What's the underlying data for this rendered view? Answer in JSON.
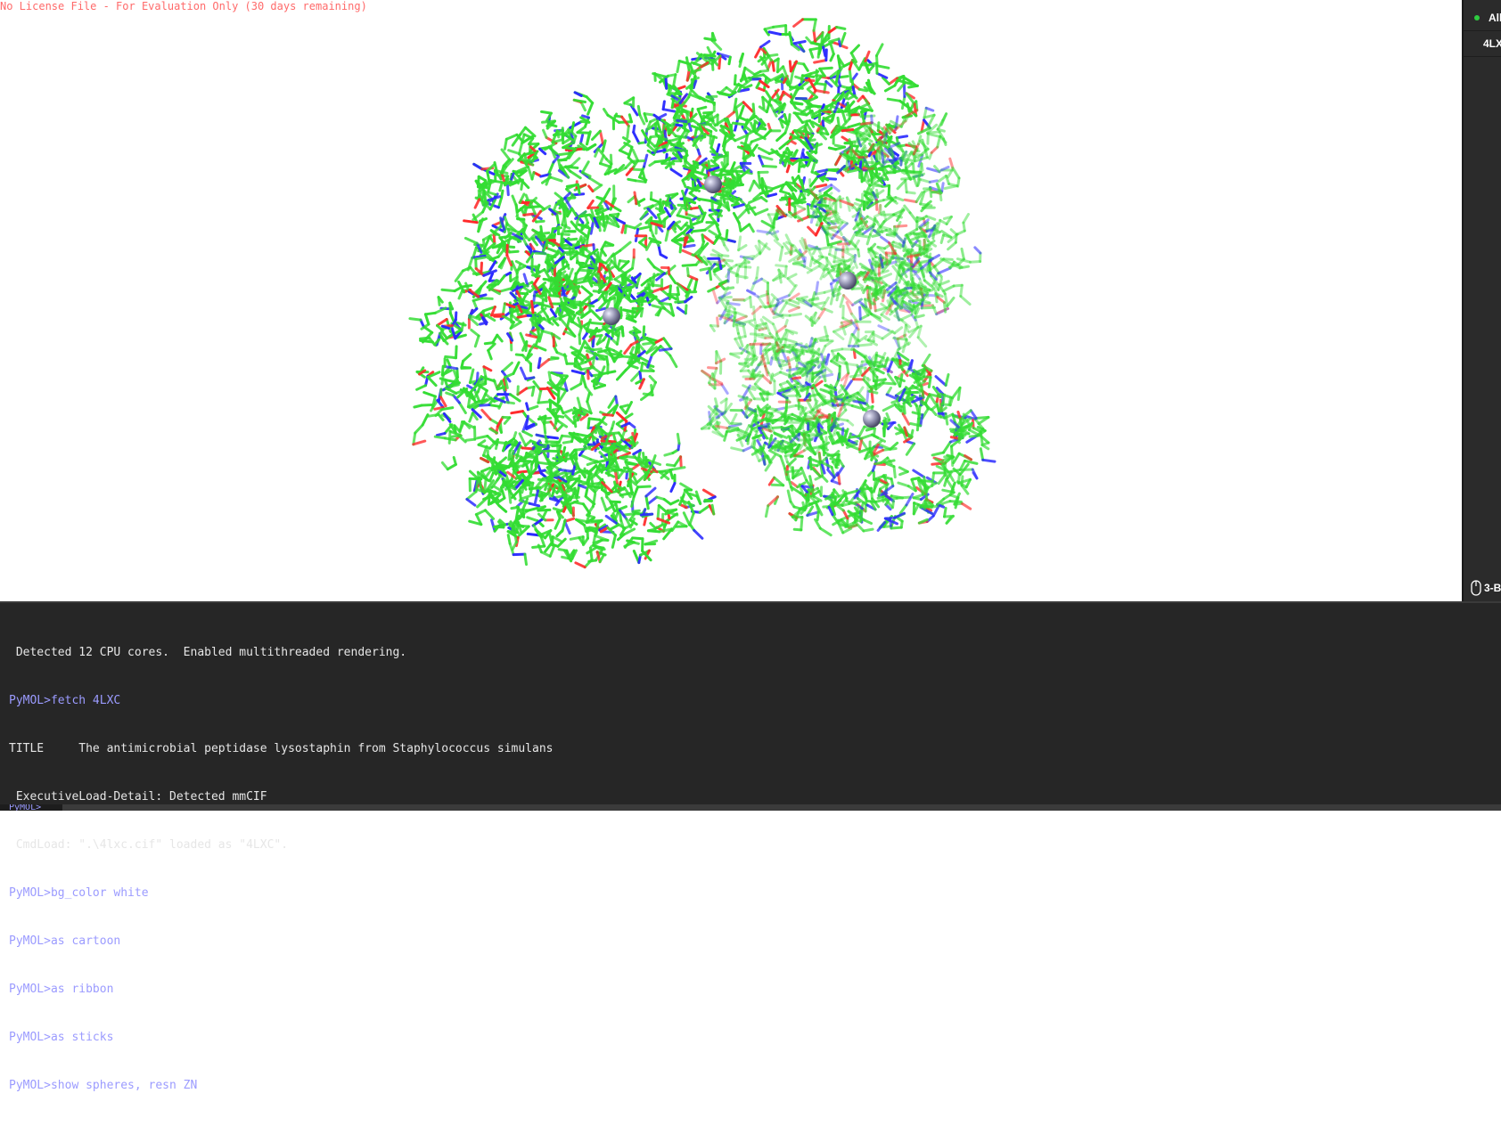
{
  "viewport": {
    "license_notice": "No License File - For Evaluation Only (30 days remaining)",
    "background_color": "#ffffff",
    "structure": "4LXC",
    "representation": "sticks",
    "zinc_atoms": "spheres (resn ZN)",
    "colors": {
      "carbon": "#33dd33",
      "nitrogen": "#2a2aff",
      "oxygen": "#ff2a2a",
      "zinc": "#8a8aa8"
    }
  },
  "object_panel": {
    "items": [
      {
        "label": "All"
      },
      {
        "label": "4LX"
      }
    ],
    "mouse_mode": "3-B"
  },
  "console": {
    "lines": [
      {
        "type": "out",
        "text": " Detected 12 CPU cores.  Enabled multithreaded rendering."
      },
      {
        "type": "cmd",
        "text": "PyMOL>fetch 4LXC"
      },
      {
        "type": "out",
        "text": "TITLE     The antimicrobial peptidase lysostaphin from Staphylococcus simulans"
      },
      {
        "type": "out",
        "text": " ExecutiveLoad-Detail: Detected mmCIF"
      },
      {
        "type": "out",
        "text": " CmdLoad: \".\\4lxc.cif\" loaded as \"4LXC\"."
      },
      {
        "type": "cmd",
        "text": "PyMOL>bg_color white"
      },
      {
        "type": "cmd",
        "text": "PyMOL>as cartoon"
      },
      {
        "type": "cmd",
        "text": "PyMOL>as ribbon"
      },
      {
        "type": "cmd",
        "text": "PyMOL>as sticks"
      },
      {
        "type": "cmd",
        "text": "PyMOL>show spheres, resn ZN"
      }
    ],
    "prompt": "PyMOL>"
  }
}
